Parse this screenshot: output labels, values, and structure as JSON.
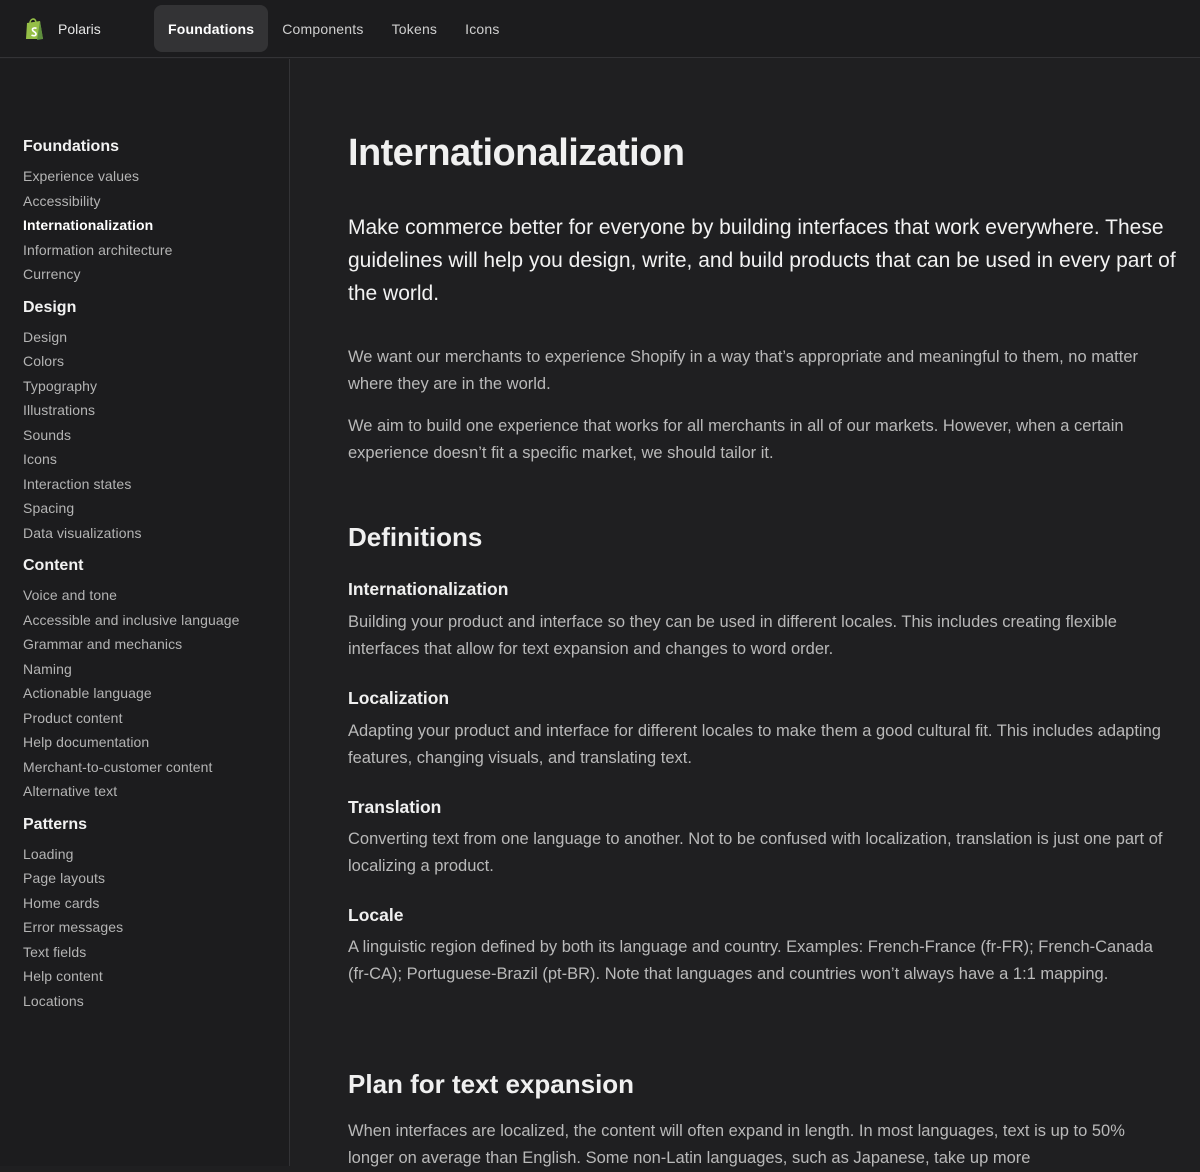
{
  "header": {
    "brand": "Polaris",
    "tabs": [
      {
        "label": "Foundations"
      },
      {
        "label": "Components"
      },
      {
        "label": "Tokens"
      },
      {
        "label": "Icons"
      }
    ]
  },
  "sidebar": {
    "groups": [
      {
        "heading": "Foundations",
        "items": [
          "Experience values",
          "Accessibility",
          "Internationalization",
          "Information architecture",
          "Currency"
        ]
      },
      {
        "heading": "Design",
        "items": [
          "Design",
          "Colors",
          "Typography",
          "Illustrations",
          "Sounds",
          "Icons",
          "Interaction states",
          "Spacing",
          "Data visualizations"
        ]
      },
      {
        "heading": "Content",
        "items": [
          "Voice and tone",
          "Accessible and inclusive language",
          "Grammar and mechanics",
          "Naming",
          "Actionable language",
          "Product content",
          "Help documentation",
          "Merchant-to-customer content",
          "Alternative text"
        ]
      },
      {
        "heading": "Patterns",
        "items": [
          "Loading",
          "Page layouts",
          "Home cards",
          "Error messages",
          "Text fields",
          "Help content",
          "Locations"
        ]
      }
    ]
  },
  "main": {
    "title": "Internationalization",
    "lead": "Make commerce better for everyone by building interfaces that work everywhere. These guidelines will help you design, write, and build products that can be used in every part of the world.",
    "intro_1": "We want our merchants to experience Shopify in a way that’s appropriate and meaningful to them, no matter where they are in the world.",
    "intro_2": "We aim to build one experience that works for all merchants in all of our markets. However, when a certain experience doesn’t fit a specific market, we should tailor it.",
    "definitions_heading": "Definitions",
    "definitions": [
      {
        "term": "Internationalization",
        "text": "Building your product and interface so they can be used in different locales. This includes creating flexible interfaces that allow for text expansion and changes to word order."
      },
      {
        "term": "Localization",
        "text": "Adapting your product and interface for different locales to make them a good cultural fit. This includes adapting features, changing visuals, and translating text."
      },
      {
        "term": "Translation",
        "text": "Converting text from one language to another. Not to be confused with localization, translation is just one part of localizing a product."
      },
      {
        "term": "Locale",
        "text": "A linguistic region defined by both its language and country. Examples: French-France (fr-FR); French-Canada (fr-CA); Portuguese-Brazil (pt-BR). Note that languages and countries won’t always have a 1:1 mapping."
      }
    ],
    "expansion_heading": "Plan for text expansion",
    "expansion_text": "When interfaces are localized, the content will often expand in length. In most languages, text is up to 50% longer on average than English. Some non-Latin languages, such as Japanese, take up more"
  },
  "colors": {
    "background": "#1f1f21",
    "logo_green": "#95bf47",
    "logo_dark_green": "#5e8e3e"
  }
}
